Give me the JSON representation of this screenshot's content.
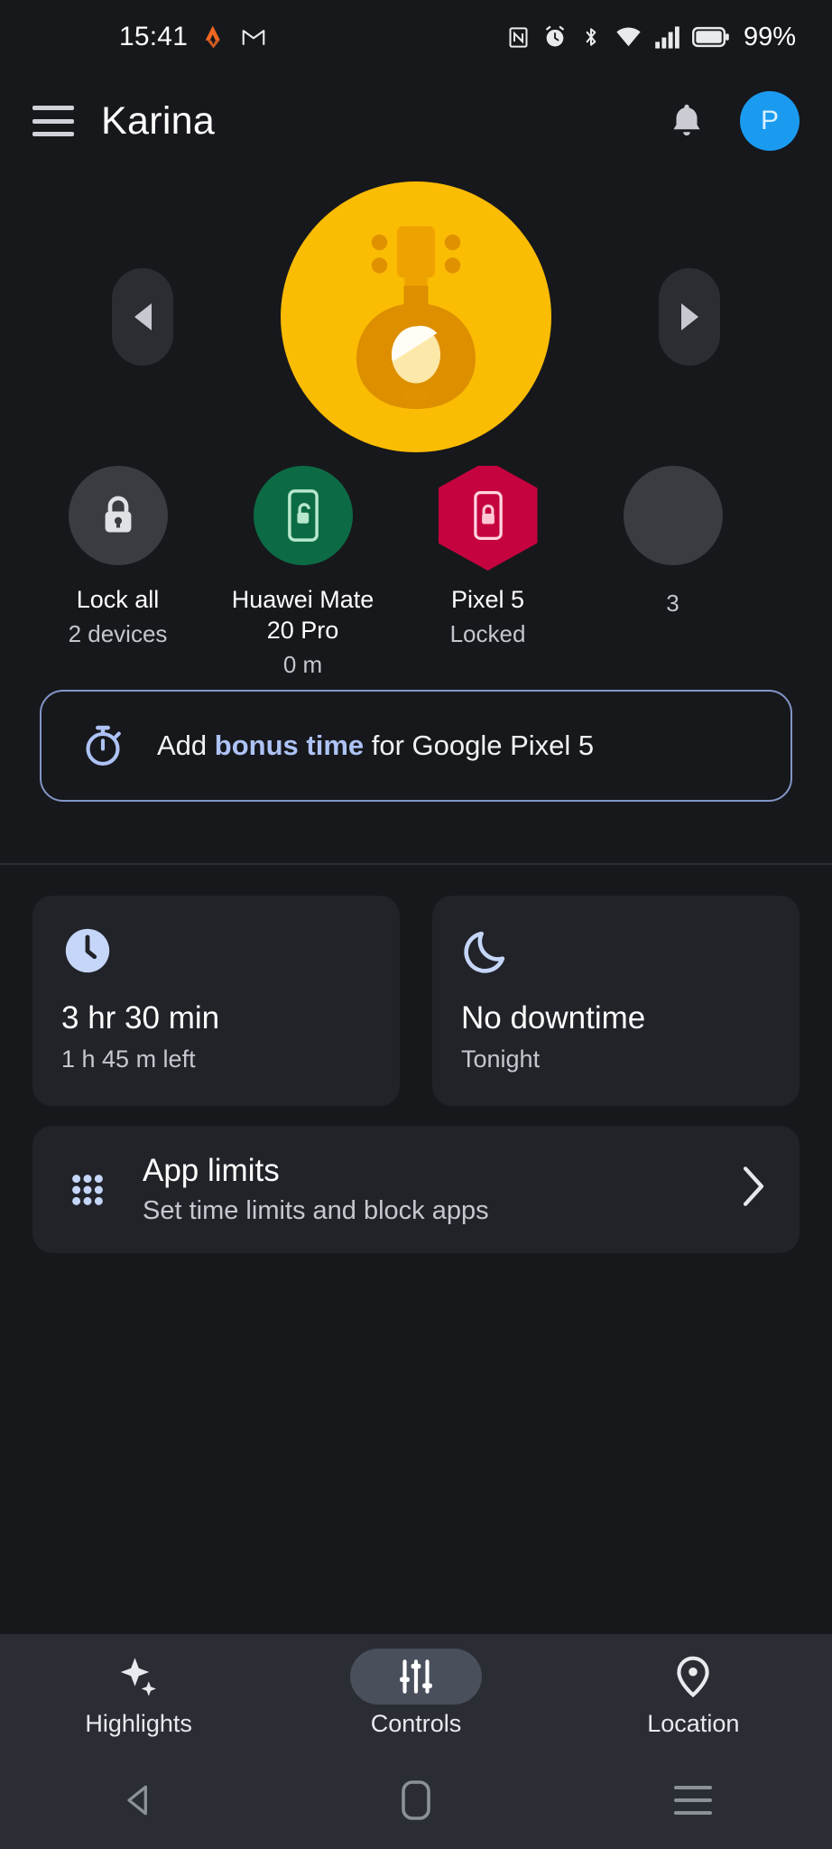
{
  "statusbar": {
    "time": "15:41",
    "battery_percent": "99%",
    "icons_left": [
      "strava-icon",
      "gmail-icon"
    ],
    "icons_right": [
      "nfc-icon",
      "alarm-icon",
      "bluetooth-icon",
      "wifi-icon",
      "cellular-signal-icon",
      "battery-icon"
    ]
  },
  "header": {
    "menu_icon": "hamburger-menu-icon",
    "title": "Karina",
    "notification_icon": "bell-icon",
    "avatar_initial": "P"
  },
  "carousel": {
    "avatar_icon": "guitar-avatar-icon",
    "prev_label": "Previous profile",
    "next_label": "Next profile",
    "avatar_color": "#fbbc04"
  },
  "devices": [
    {
      "name": "Lock all",
      "sub": "2 devices",
      "icon": "lock-closed-icon",
      "shape": "circle",
      "color": "#3a3c42",
      "icon_color": "#dfe1e5"
    },
    {
      "name": "Huawei Mate 20 Pro",
      "sub": "0 m",
      "icon": "phone-unlocked-icon",
      "shape": "circle",
      "color": "#0c6b45",
      "icon_color": "#b7e7cd"
    },
    {
      "name": "Pixel 5",
      "sub": "Locked",
      "icon": "phone-locked-icon",
      "shape": "hexagon",
      "color": "#c5033f",
      "icon_color": "#ffc6d6"
    },
    {
      "name": "",
      "sub": "3",
      "icon": "device-icon",
      "shape": "circle",
      "color": "#3a3c42",
      "icon_color": "#dfe1e5"
    }
  ],
  "bonus_time": {
    "icon": "stopwatch-icon",
    "text_before": "Add ",
    "text_highlight": "bonus time",
    "text_after": " for Google Pixel 5",
    "border_color": "#8296c8",
    "highlight_color": "#aec3f5"
  },
  "cards": [
    {
      "icon": "clock-filled-icon",
      "title": "3 hr 30 min",
      "sub": "1 h 45 m left"
    },
    {
      "icon": "moon-outline-icon",
      "title": "No downtime",
      "sub": "Tonight"
    }
  ],
  "app_limits": {
    "icon": "app-grid-icon",
    "title": "App limits",
    "sub": "Set time limits and block apps",
    "chevron": "chevron-right-icon"
  },
  "bottom_nav": [
    {
      "label": "Highlights",
      "icon": "sparkle-icon",
      "active": false
    },
    {
      "label": "Controls",
      "icon": "sliders-icon",
      "active": true
    },
    {
      "label": "Location",
      "icon": "map-pin-icon",
      "active": false
    }
  ],
  "system_nav": [
    {
      "label": "Back",
      "icon": "back-triangle-icon"
    },
    {
      "label": "Home",
      "icon": "home-rect-icon"
    },
    {
      "label": "Recents",
      "icon": "recents-lines-icon"
    }
  ]
}
